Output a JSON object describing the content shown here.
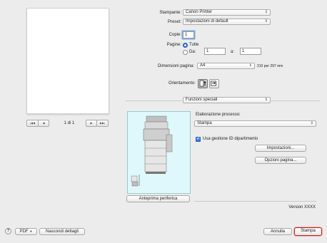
{
  "preview": {
    "page_indicator": "1 di 1",
    "nav": {
      "first": "|◀◀",
      "prev": "◀",
      "next": "▶",
      "last": "▶▶|"
    }
  },
  "printer": {
    "label": "Stampante:",
    "value": "Canon Printer"
  },
  "preset": {
    "label": "Preset:",
    "value": "Impostazioni di default"
  },
  "copies": {
    "label": "Copie:",
    "value": "1"
  },
  "pages": {
    "label": "Pagine:",
    "all_label": "Tutte",
    "from_label": "Da:",
    "from_value": "1",
    "to_label": "a:",
    "to_value": "1",
    "selected": "all"
  },
  "paper_size": {
    "label": "Dimensioni pagina:",
    "value": "A4",
    "dimensions": "210 per 297 mm"
  },
  "orientation": {
    "label": "Orientamento:"
  },
  "section": {
    "value": "Funzioni speciali"
  },
  "processing": {
    "label": "Elaborazione processo:",
    "value": "Stampa"
  },
  "department": {
    "checkbox_label": "Usa gestione ID dipartimento",
    "checked": true
  },
  "buttons": {
    "settings": "Impostazioni...",
    "page_options": "Opzioni pagina...",
    "device_preview": "Anteprima periferica",
    "pdf": "PDF",
    "hide_details": "Nascondi dettagli",
    "cancel": "Annulla",
    "print": "Stampa",
    "help": "?"
  },
  "version": "Version XXXX",
  "colors": {
    "accent": "#2f6fd9",
    "print_highlight": "#d01818",
    "preview_bg": "#dff8fb"
  }
}
